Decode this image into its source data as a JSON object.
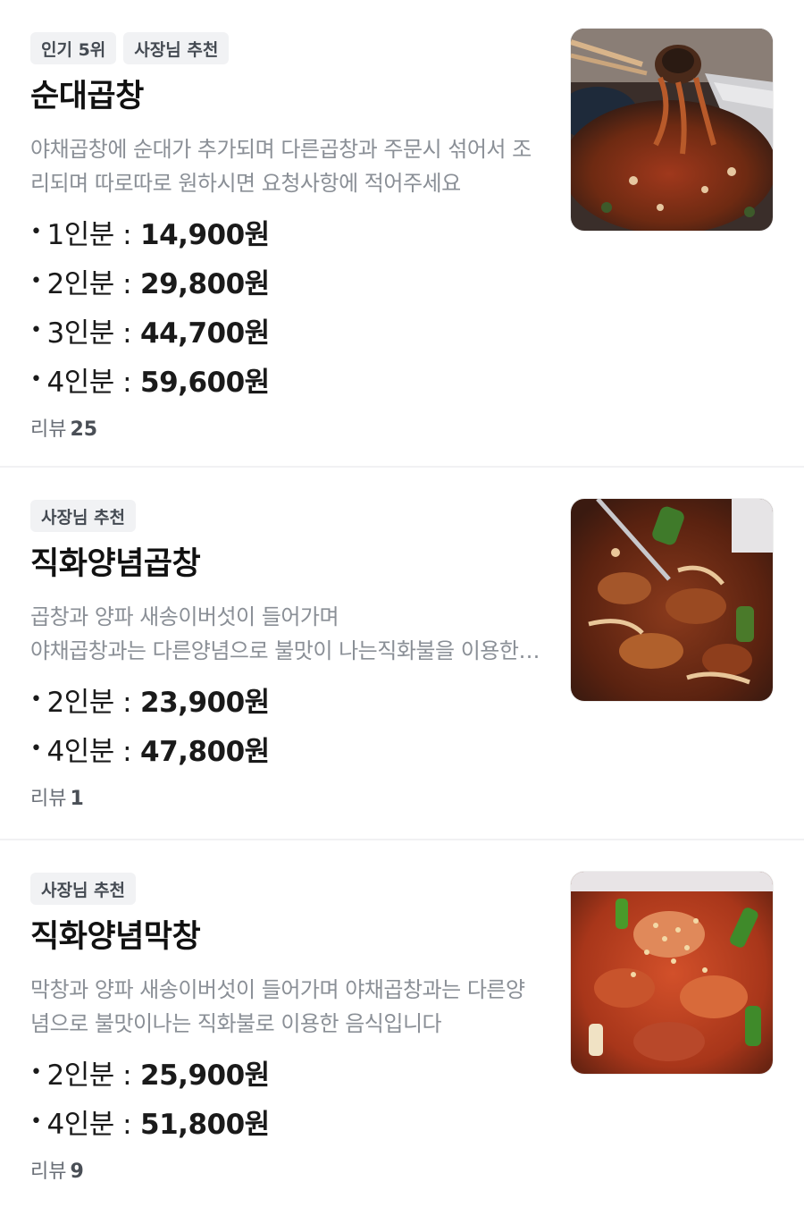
{
  "menu_items": [
    {
      "badges": [
        "인기 5위",
        "사장님 추천"
      ],
      "name": "순대곱창",
      "description": "야채곱창에 순대가 추가되며 다른곱창과 주문시 섞어서 조리되며 따로따로 원하시면 요청사항에 적어주세요",
      "prices": [
        {
          "label": "1인분 :",
          "value": "14,900원"
        },
        {
          "label": "2인분 :",
          "value": "29,800원"
        },
        {
          "label": "3인분 :",
          "value": "44,700원"
        },
        {
          "label": "4인분 :",
          "value": "59,600원"
        }
      ],
      "review_label": "리뷰",
      "review_count": "25",
      "image": "sundae-gopchang-photo"
    },
    {
      "badges": [
        "사장님 추천"
      ],
      "name": "직화양념곱창",
      "description": "곱창과 양파 새송이버섯이 들어가며\n야채곱창과는 다른양념으로 불맛이 나는직화불을 이용한 음식입니다",
      "prices": [
        {
          "label": "2인분 :",
          "value": "23,900원"
        },
        {
          "label": "4인분 :",
          "value": "47,800원"
        }
      ],
      "review_label": "리뷰",
      "review_count": "1",
      "image": "spicy-gopchang-photo"
    },
    {
      "badges": [
        "사장님 추천"
      ],
      "name": "직화양념막창",
      "description": "막창과 양파 새송이버섯이 들어가며 야채곱창과는 다른양념으로 불맛이나는 직화불로 이용한 음식입니다",
      "prices": [
        {
          "label": "2인분 :",
          "value": "25,900원"
        },
        {
          "label": "4인분 :",
          "value": "51,800원"
        }
      ],
      "review_label": "리뷰",
      "review_count": "9",
      "image": "spicy-makchang-photo"
    }
  ]
}
